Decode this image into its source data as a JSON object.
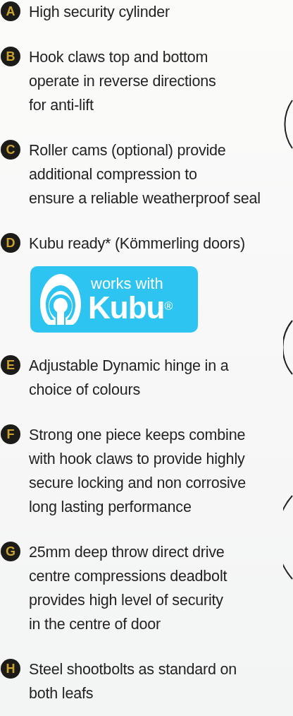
{
  "features": [
    {
      "badge": "A",
      "lines": [
        "High security cylinder"
      ]
    },
    {
      "badge": "B",
      "lines": [
        "Hook claws top and bottom",
        "operate in reverse directions",
        "for anti-lift"
      ]
    },
    {
      "badge": "C",
      "lines": [
        "Roller cams (optional) provide",
        "additional compression to",
        "ensure a reliable weatherproof seal"
      ]
    },
    {
      "badge": "D",
      "lines": [
        "Kubu ready* (Kömmerling doors)"
      ],
      "logo": {
        "tagline": "works with",
        "brand": "Kubu",
        "mark": "®"
      }
    },
    {
      "badge": "E",
      "lines": [
        "Adjustable Dynamic hinge in a",
        "choice of colours"
      ]
    },
    {
      "badge": "F",
      "lines": [
        "Strong one piece keeps combine",
        "with hook claws to provide highly",
        "secure locking and non corrosive",
        "long lasting performance"
      ]
    },
    {
      "badge": "G",
      "lines": [
        "25mm deep throw direct drive",
        "centre compressions deadbolt",
        "provides high level of security",
        "in the centre of door"
      ]
    },
    {
      "badge": "H",
      "lines": [
        "Steel shootbolts as standard on",
        "both leafs"
      ]
    }
  ]
}
